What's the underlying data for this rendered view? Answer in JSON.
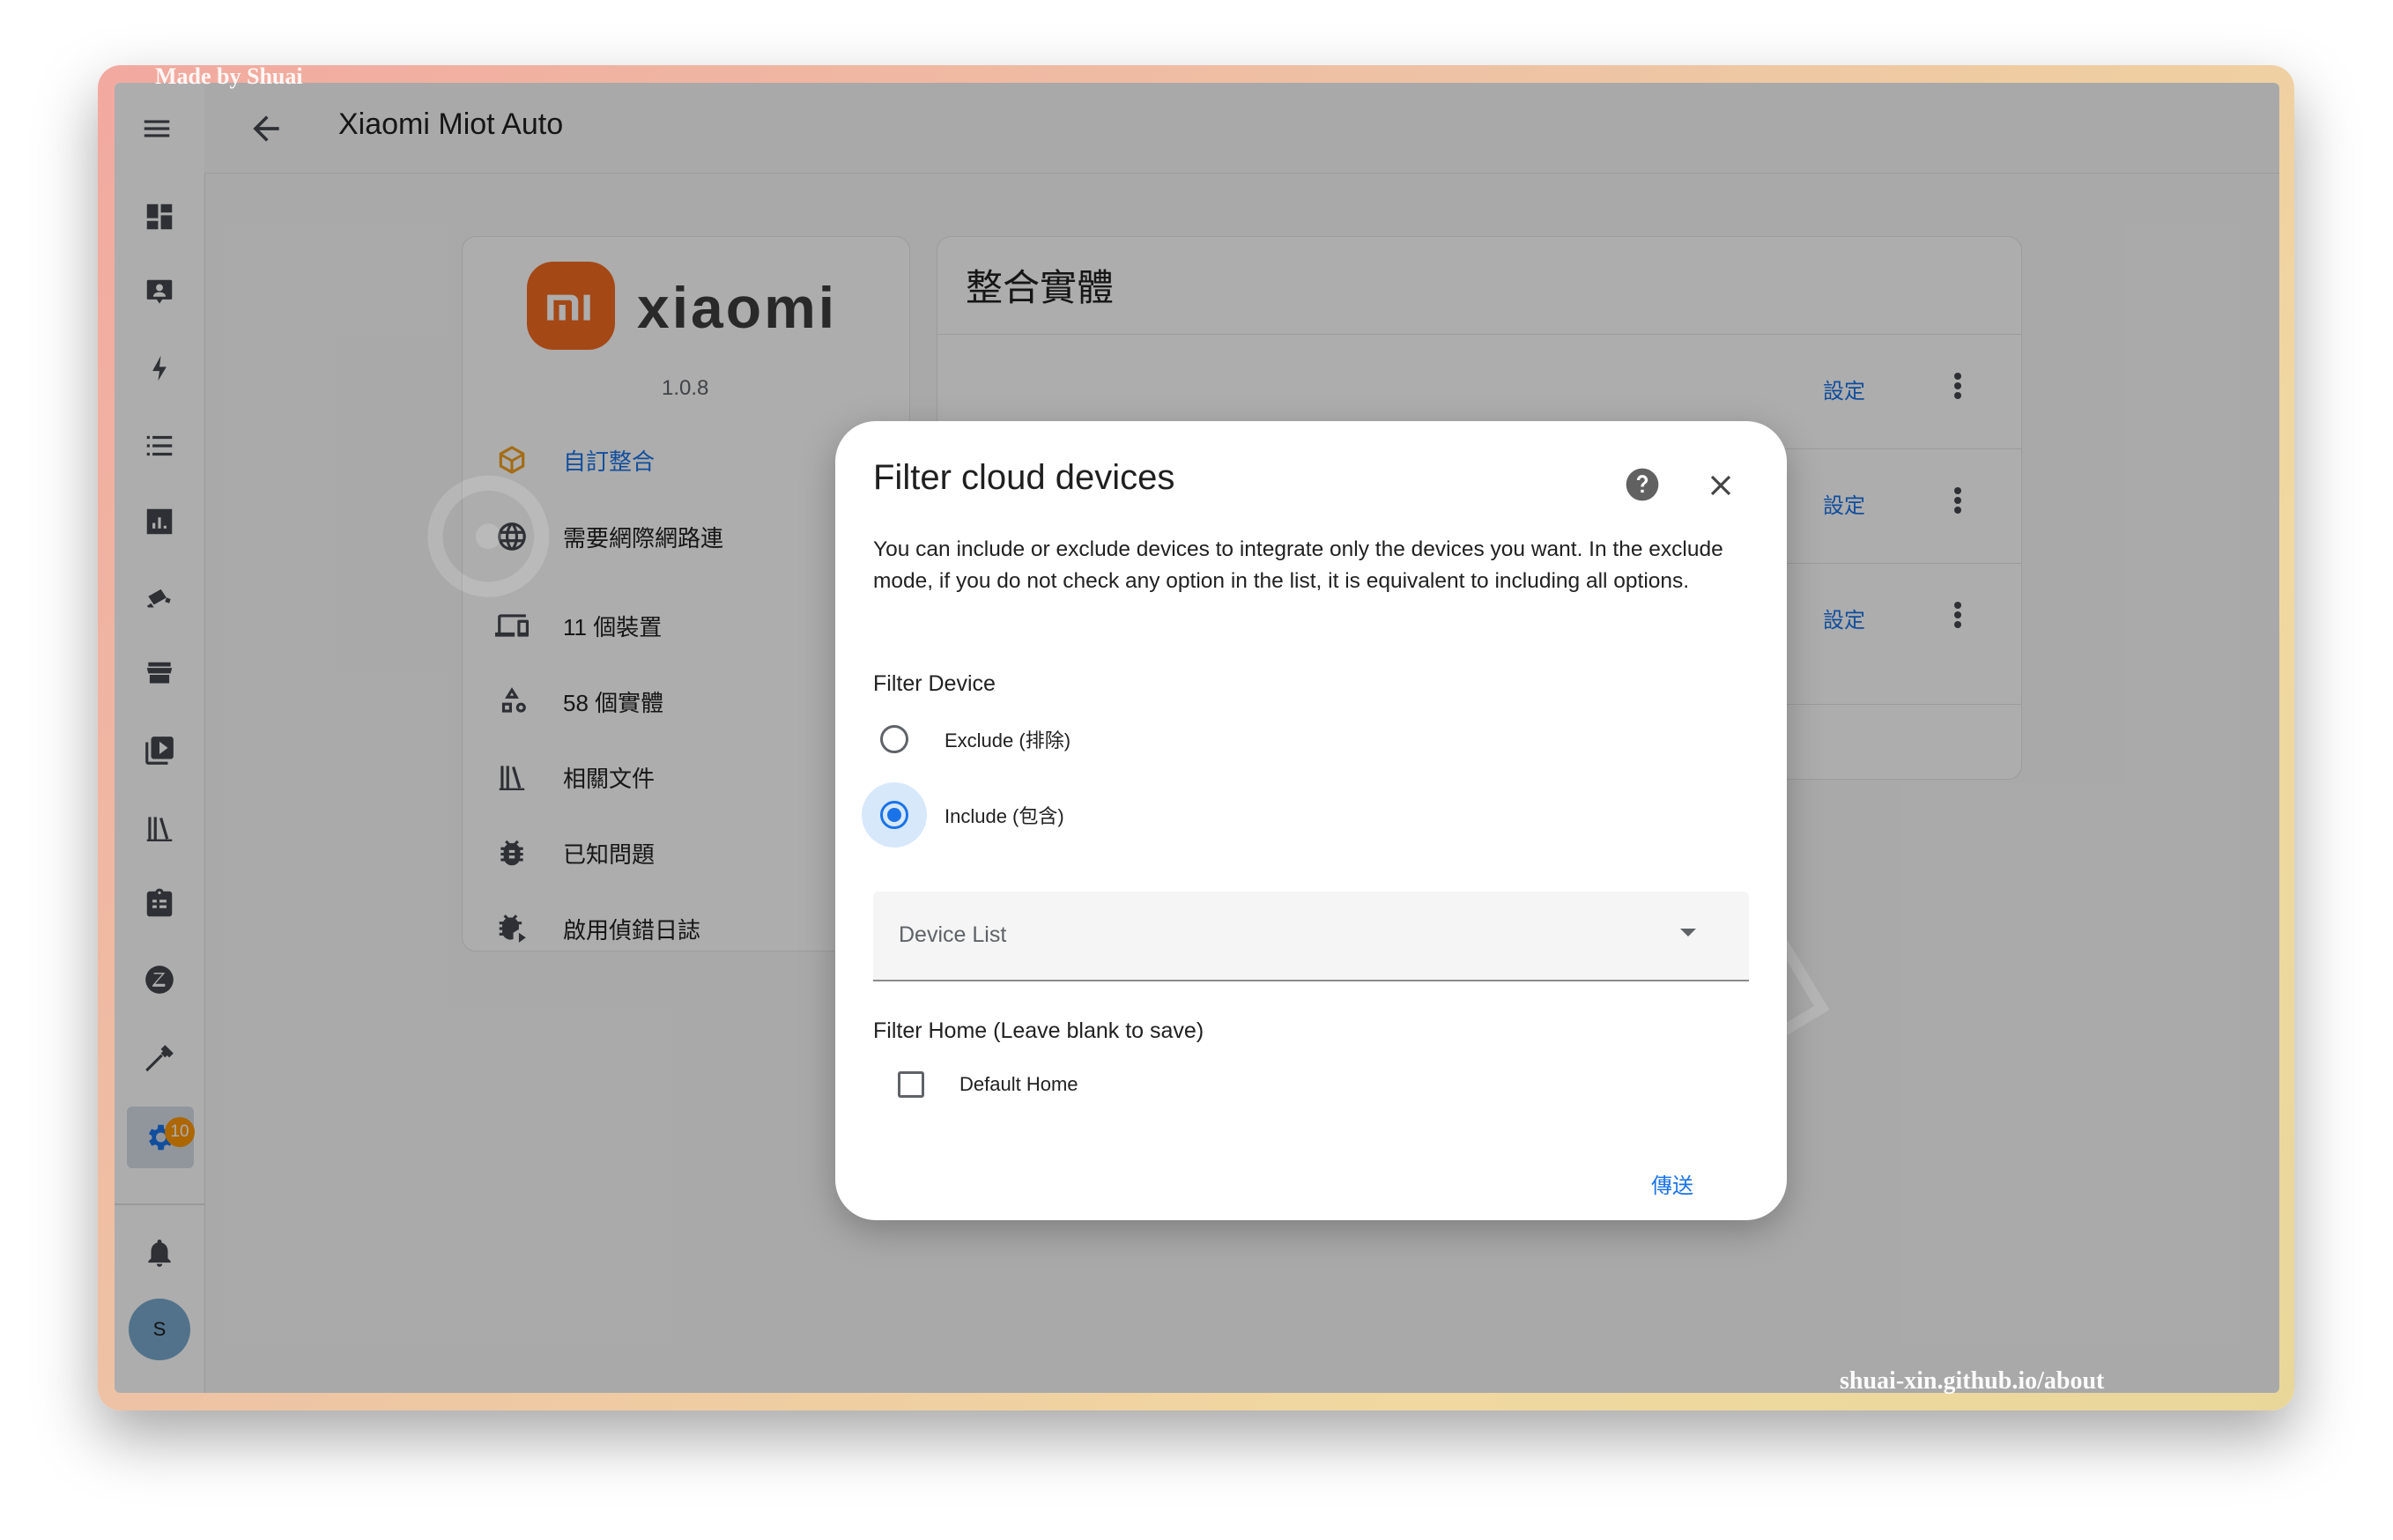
{
  "watermark": {
    "top": "Made by Shuai",
    "bottom": "shuai-xin.github.io/about"
  },
  "header": {
    "title": "Xiaomi Miot Auto"
  },
  "sidebar": {
    "items": [
      {
        "icon": "dashboard-icon"
      },
      {
        "icon": "person-board-icon"
      },
      {
        "icon": "lightning-icon"
      },
      {
        "icon": "list-icon"
      },
      {
        "icon": "chart-icon"
      },
      {
        "icon": "camera-icon"
      },
      {
        "icon": "hacs-store-icon"
      },
      {
        "icon": "media-icon"
      },
      {
        "icon": "library-icon"
      },
      {
        "icon": "clipboard-icon"
      },
      {
        "icon": "zigbee-icon"
      },
      {
        "icon": "hammer-icon"
      },
      {
        "icon": "gear-icon"
      }
    ],
    "settings_badge": "10",
    "notification_icon": "bell-icon",
    "avatar_initial": "S"
  },
  "integration": {
    "brand": "xiaomi",
    "version": "1.0.8",
    "menu": [
      {
        "label": "自訂整合",
        "icon": "package-icon",
        "link": true
      },
      {
        "label": "需要網際網路連",
        "icon": "globe-icon",
        "link": false
      },
      {
        "label": "11 個裝置",
        "icon": "devices-icon",
        "link": false
      },
      {
        "label": "58 個實體",
        "icon": "shapes-icon",
        "link": false
      },
      {
        "label": "相關文件",
        "icon": "library-icon",
        "link": false
      },
      {
        "label": "已知問題",
        "icon": "bug-icon",
        "link": false
      },
      {
        "label": "啟用偵錯日誌",
        "icon": "bug-play-icon",
        "link": false
      }
    ]
  },
  "entries": {
    "title": "整合實體",
    "rows": [
      {
        "action": "設定"
      },
      {
        "action": "設定"
      },
      {
        "action": "設定"
      }
    ]
  },
  "dialog": {
    "title": "Filter cloud devices",
    "description": "You can include or exclude devices to integrate only the devices you want. In the exclude mode, if you do not check any option in the list, it is equivalent to including all options.",
    "filter_device_label": "Filter Device",
    "options": [
      {
        "label": "Exclude (排除)",
        "selected": false
      },
      {
        "label": "Include (包含)",
        "selected": true
      }
    ],
    "select_label": "Device List",
    "filter_home_label": "Filter Home (Leave blank to save)",
    "home_option": {
      "label": "Default Home",
      "checked": false
    },
    "submit_label": "傳送"
  },
  "colors": {
    "accent": "#1a73e8",
    "brand": "#f26b21",
    "badge": "#ff9800"
  }
}
